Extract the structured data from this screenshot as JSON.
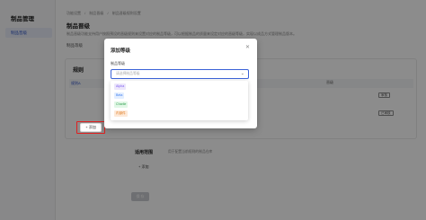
{
  "sidebar": {
    "app_title": "制品管理",
    "items": [
      {
        "label": "制品晋级"
      }
    ]
  },
  "breadcrumb": [
    "功能设置",
    "/",
    "制品晋级",
    "/",
    "制品晋级规则设置"
  ],
  "page": {
    "title": "制品晋级",
    "description": "制品晋级功能支持用户按照预设的晋级规则来设置对应的制品等级，可以根据制品的质量来设定对应的晋级等级，实现以成品方式管理制品版本。",
    "level_label": "制品等级"
  },
  "rules": {
    "title": "规则",
    "row_label": "规则A",
    "col_label": "晋级",
    "pills": [
      "审核",
      "已审核"
    ]
  },
  "add_button": "+ 添加",
  "scope": {
    "title": "适用范围",
    "description": "用于配置当前规则的制品仓库",
    "add_label": "+ 添加"
  },
  "submit_label": "保 存",
  "modal": {
    "title": "添加等级",
    "close_icon": "close-icon",
    "field_label": "制品等级",
    "select_placeholder": "请选择制品等级",
    "options": [
      {
        "label": "Alpha",
        "bg": "#ece6fb",
        "fg": "#7a5af0"
      },
      {
        "label": "Beta",
        "bg": "#e3eeff",
        "fg": "#3a7bef"
      },
      {
        "label": "Charlie",
        "bg": "#e1f7e6",
        "fg": "#2f9e4f"
      },
      {
        "label": "内部件",
        "bg": "#fde9d8",
        "fg": "#e07a1f"
      }
    ]
  },
  "colors": {
    "accent": "#3a62d7",
    "highlight": "#e02020"
  }
}
